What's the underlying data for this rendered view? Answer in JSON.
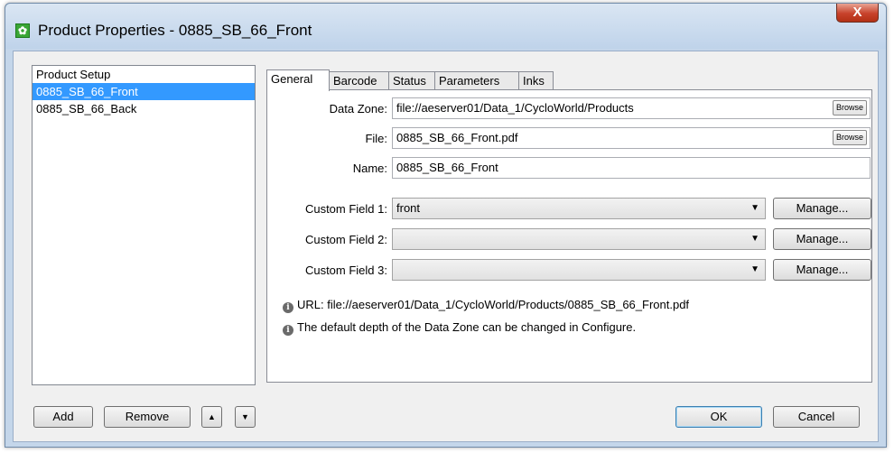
{
  "window": {
    "title": "Product Properties - 0885_SB_66_Front",
    "app_icon": "gear-icon",
    "close_glyph": "X"
  },
  "product_list": {
    "header": "Product Setup",
    "items": [
      {
        "label": "0885_SB_66_Front",
        "selected": true
      },
      {
        "label": "0885_SB_66_Back",
        "selected": false
      }
    ]
  },
  "list_buttons": {
    "add": "Add",
    "remove": "Remove",
    "move_up": "▲",
    "move_down": "▼"
  },
  "tabs": [
    {
      "label": "General",
      "active": true
    },
    {
      "label": "Barcode",
      "active": false
    },
    {
      "label": "Status",
      "active": false
    },
    {
      "label": "Parameters",
      "active": false
    },
    {
      "label": "Inks",
      "active": false
    }
  ],
  "general": {
    "data_zone_label": "Data Zone:",
    "data_zone_value": "file://aeserver01/Data_1/CycloWorld/Products",
    "file_label": "File:",
    "file_value": "0885_SB_66_Front.pdf",
    "browse_label": "Browse",
    "name_label": "Name:",
    "name_value": "0885_SB_66_Front",
    "custom_fields": [
      {
        "label": "Custom Field 1:",
        "value": "front"
      },
      {
        "label": "Custom Field 2:",
        "value": ""
      },
      {
        "label": "Custom Field 3:",
        "value": ""
      }
    ],
    "manage_label": "Manage...",
    "url_info": "URL: file://aeserver01/Data_1/CycloWorld/Products/0885_SB_66_Front.pdf",
    "depth_info": "The default depth of the Data Zone can be changed in Configure.",
    "info_glyph": "i"
  },
  "dialog_buttons": {
    "ok": "OK",
    "cancel": "Cancel"
  }
}
